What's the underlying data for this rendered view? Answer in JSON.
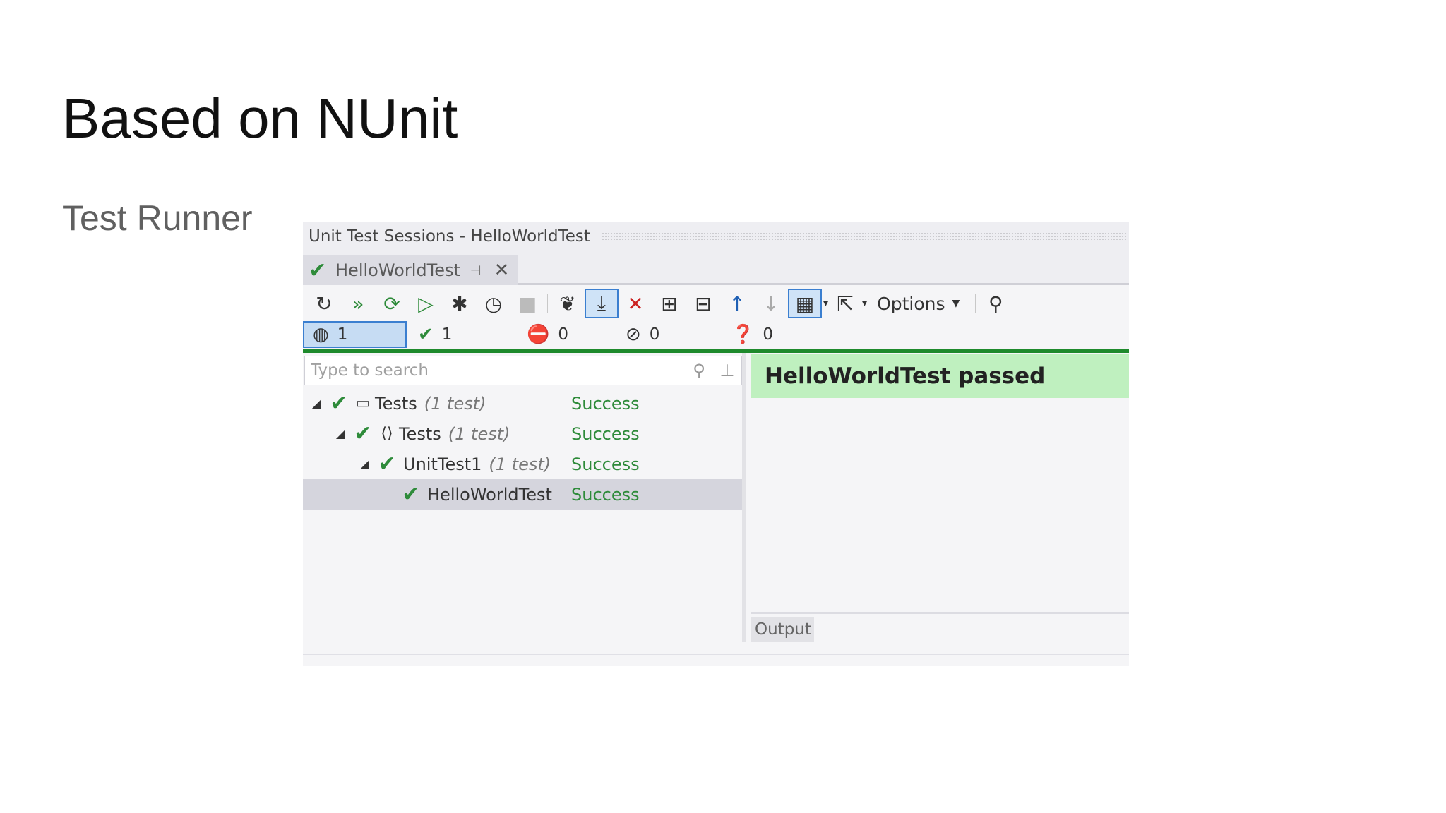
{
  "slide": {
    "title": "Based on NUnit",
    "subtitle": "Test Runner"
  },
  "window": {
    "title": "Unit Test Sessions - HelloWorldTest",
    "tab": {
      "label": "HelloWorldTest",
      "icon": "check-icon",
      "pin_icon": "pin-icon",
      "close_icon": "close-icon"
    },
    "toolbar": {
      "buttons": [
        "refresh-icon",
        "run-all-icon",
        "run-continuous-icon",
        "run-icon",
        "debug-icon",
        "profile-icon",
        "stop-icon",
        "track-running-icon",
        "autoscroll-icon",
        "remove-icon",
        "expand-all-icon",
        "collapse-all-icon",
        "previous-failed-icon",
        "next-failed-icon",
        "layout-icon",
        "export-icon"
      ],
      "options_label": "Options"
    },
    "counters": {
      "total": "1",
      "passed": "1",
      "failed": "0",
      "ignored": "0",
      "unknown": "0"
    },
    "search": {
      "placeholder": "Type to search"
    },
    "tree": [
      {
        "name": "Tests",
        "count": "(1 test)",
        "status": "Success",
        "icon": "project-icon",
        "indent": 0
      },
      {
        "name": "Tests",
        "count": "(1 test)",
        "status": "Success",
        "icon": "namespace-icon",
        "indent": 1
      },
      {
        "name": "UnitTest1",
        "count": "(1 test)",
        "status": "Success",
        "icon": "",
        "indent": 2
      },
      {
        "name": "HelloWorldTest",
        "count": "",
        "status": "Success",
        "icon": "",
        "indent": 3
      }
    ],
    "result": "HelloWorldTest passed",
    "output_tab": "Output"
  },
  "colors": {
    "success": "#2e8b3a",
    "result_bg": "#bff0bf",
    "status_bar": "#1e8a2c",
    "selection": "#3b7fd0"
  }
}
